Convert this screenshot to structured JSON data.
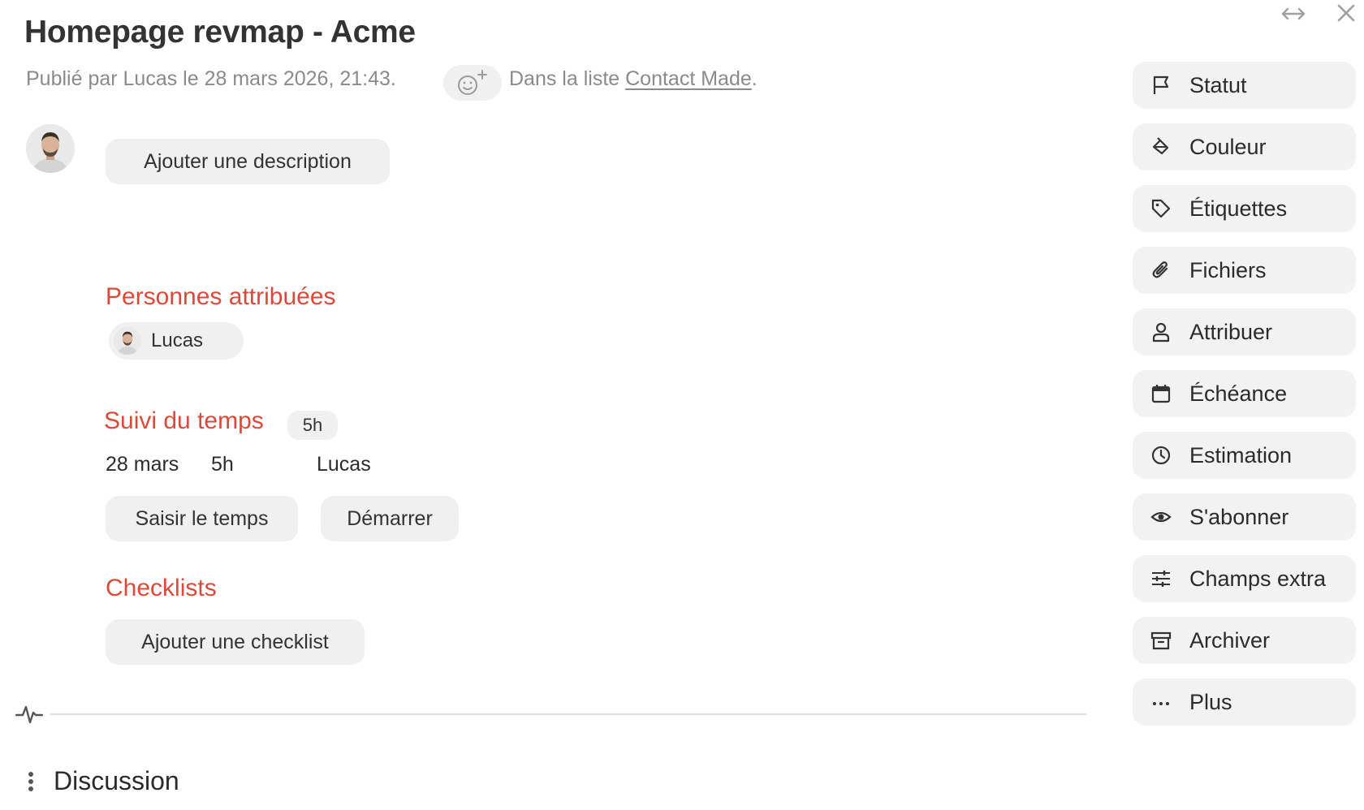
{
  "task": {
    "title": "Homepage revmap - Acme",
    "meta": "Publié par Lucas le 28 mars 2026, 21:43.",
    "list_prefix": "Dans la liste",
    "list_name": "Contact Made",
    "list_suffix": "."
  },
  "description": {
    "add_label": "Ajouter une description"
  },
  "assignees": {
    "title": "Personnes attribuées",
    "people": [
      "Lucas"
    ]
  },
  "time_tracking": {
    "title": "Suivi du temps",
    "total_badge": "5h",
    "entries": [
      {
        "date": "28 mars",
        "duration": "5h",
        "person": "Lucas"
      }
    ],
    "enter_time_label": "Saisir le temps",
    "start_label": "Démarrer"
  },
  "checklists": {
    "title": "Checklists",
    "add_label": "Ajouter une checklist"
  },
  "sidebar": {
    "actions": [
      {
        "label": "Statut",
        "icon": "flag-icon"
      },
      {
        "label": "Couleur",
        "icon": "paint-bucket-icon"
      },
      {
        "label": "Étiquettes",
        "icon": "tag-icon"
      },
      {
        "label": "Fichiers",
        "icon": "paperclip-icon"
      },
      {
        "label": "Attribuer",
        "icon": "user-icon"
      },
      {
        "label": "Échéance",
        "icon": "calendar-icon"
      },
      {
        "label": "Estimation",
        "icon": "clock-icon"
      },
      {
        "label": "S'abonner",
        "icon": "eye-icon"
      },
      {
        "label": "Champs extra",
        "icon": "sliders-icon"
      },
      {
        "label": "Archiver",
        "icon": "archive-icon"
      },
      {
        "label": "Plus",
        "icon": "more-icon"
      }
    ]
  },
  "discussion": {
    "title": "Discussion"
  },
  "colors": {
    "accent_red": "#d94a3b",
    "button_bg": "#f0f0f0",
    "muted_text": "#8a8a8a"
  }
}
